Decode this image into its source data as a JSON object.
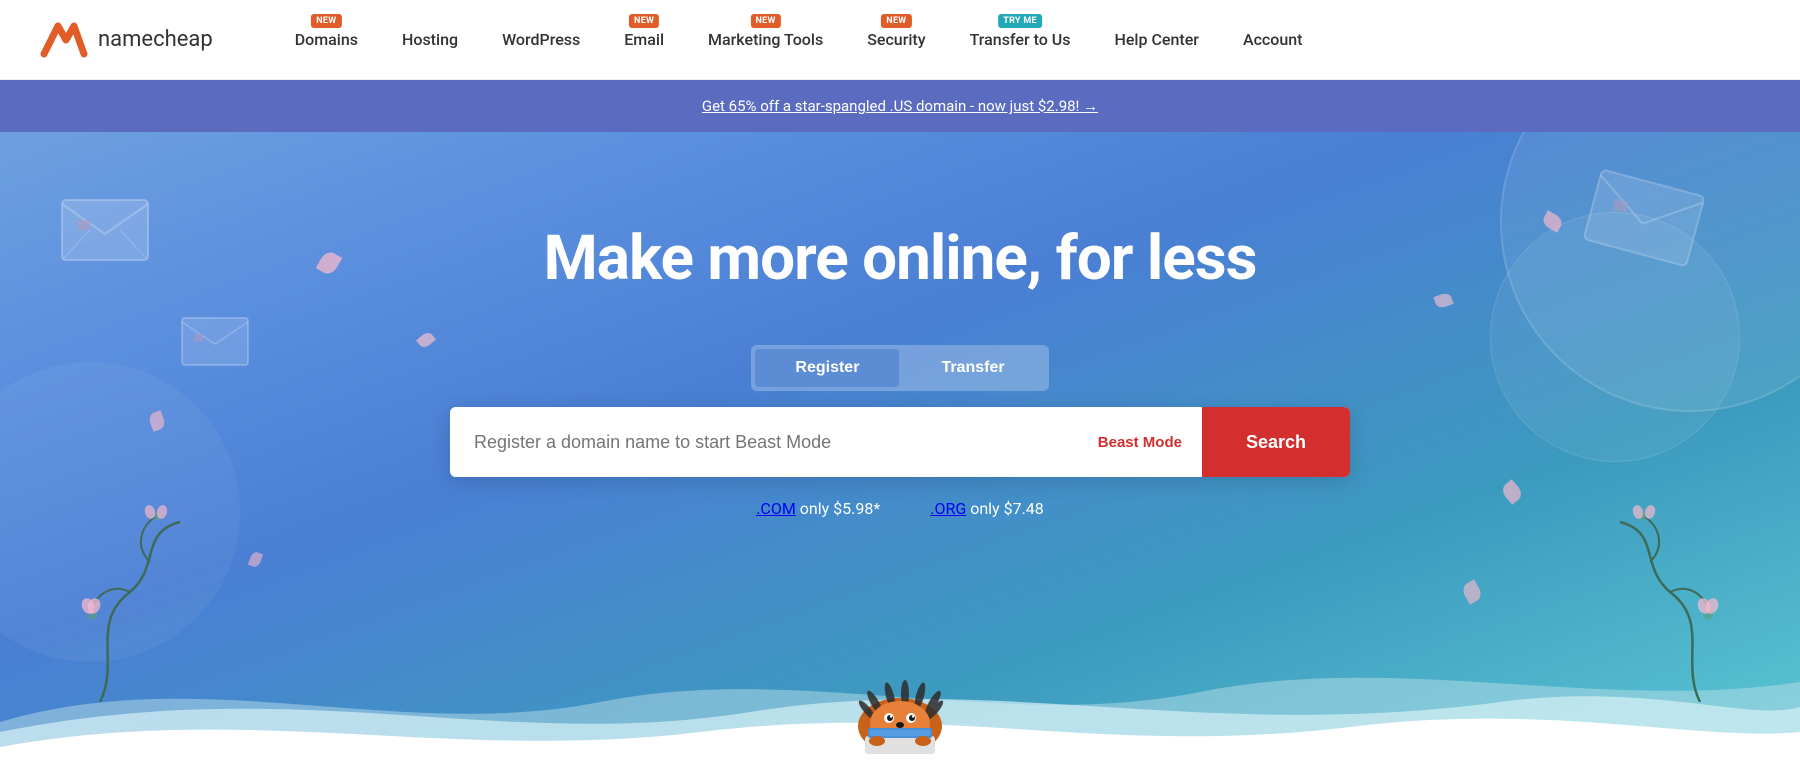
{
  "logo": {
    "text": "namecheap"
  },
  "nav": {
    "items": [
      {
        "label": "Domains",
        "badge": "NEW",
        "badge_type": "orange"
      },
      {
        "label": "Hosting",
        "badge": null,
        "badge_type": null
      },
      {
        "label": "WordPress",
        "badge": null,
        "badge_type": null
      },
      {
        "label": "Email",
        "badge": "NEW",
        "badge_type": "orange"
      },
      {
        "label": "Marketing Tools",
        "badge": "NEW",
        "badge_type": "orange"
      },
      {
        "label": "Security",
        "badge": "NEW",
        "badge_type": "orange"
      },
      {
        "label": "Transfer to Us",
        "badge": "TRY ME",
        "badge_type": "teal"
      },
      {
        "label": "Help Center",
        "badge": null,
        "badge_type": null
      },
      {
        "label": "Account",
        "badge": null,
        "badge_type": null
      }
    ]
  },
  "promo": {
    "text": "Get 65% off a star-spangled .US domain - now just $2.98! →"
  },
  "hero": {
    "title": "Make more online, for less",
    "tabs": [
      {
        "label": "Register",
        "active": true
      },
      {
        "label": "Transfer",
        "active": false
      }
    ],
    "search": {
      "placeholder": "Register a domain name to start Beast Mode",
      "beast_mode_label": "Beast Mode",
      "search_label": "Search"
    },
    "price_hints": [
      {
        "tld": ".COM",
        "text": " only $5.98*"
      },
      {
        "tld": ".ORG",
        "text": " only $7.48"
      }
    ]
  }
}
